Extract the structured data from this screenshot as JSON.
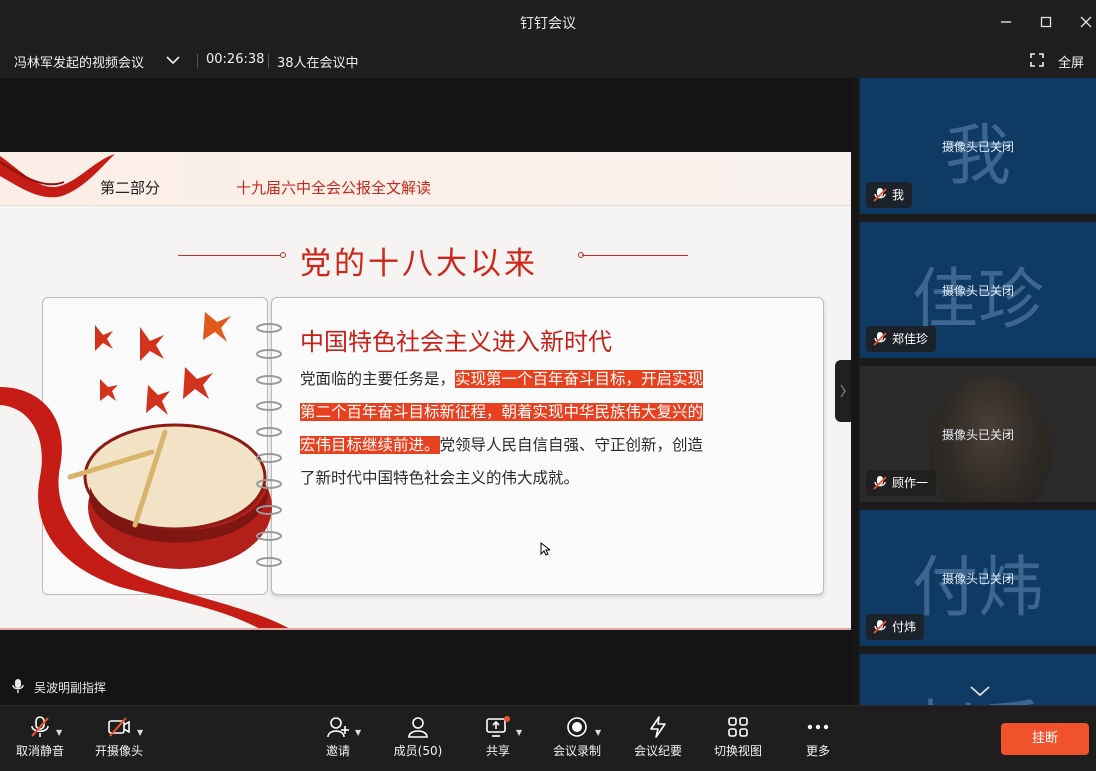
{
  "window": {
    "title": "钉钉会议",
    "controls": [
      "minimize-icon",
      "maximize-icon",
      "close-icon"
    ]
  },
  "infobar": {
    "meeting_title": "冯林军发起的视频会议",
    "elapsed": "00:26:38",
    "participants_in_meeting": "38人在会议中",
    "fullscreen_label": "全屏"
  },
  "slide": {
    "part_label": "第二部分",
    "part_title": "十九届六中全会公报全文解读",
    "heading": "党的十八大以来",
    "card_title": "中国特色社会主义进入新时代",
    "body_intro": "党面临的主要任务是，",
    "body_highlight_1": "实现第一个百年奋斗目标，开启实现",
    "body_highlight_2": "第二个百年奋斗目标新征程，朝着实现中华民族伟大复兴的",
    "body_highlight_3": "宏伟目标继续前进。",
    "body_rest_1": "党领导人民自信自强、守正创新，创造",
    "body_rest_2": "了新时代中国特色社会主义的伟大成就。"
  },
  "speaker": {
    "text": "吴波明副指挥"
  },
  "participants": [
    {
      "big": "我",
      "status": "摄像头已关闭",
      "name": "我"
    },
    {
      "big": "佳珍",
      "status": "摄像头已关闭",
      "name": "郑佳珍"
    },
    {
      "big": "",
      "status": "摄像头已关闭",
      "name": "顾作一"
    },
    {
      "big": "付炜",
      "status": "摄像头已关闭",
      "name": "付炜"
    },
    {
      "big": "赵斤",
      "status": "",
      "name": ""
    }
  ],
  "toolbar": {
    "unmute": "取消静音",
    "camera": "开摄像头",
    "invite": "邀请",
    "members": "成员(50)",
    "share": "共享",
    "record": "会议录制",
    "minutes": "会议纪要",
    "switch_view": "切换视图",
    "more": "更多",
    "hangup": "挂断"
  },
  "colors": {
    "accent": "#f0532c",
    "tile": "#0e3a63",
    "slide_red": "#d0261a",
    "highlight": "#e8411f"
  }
}
